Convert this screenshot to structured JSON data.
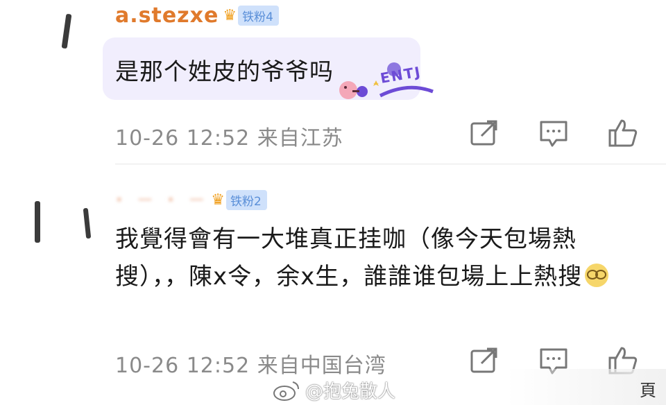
{
  "comments": [
    {
      "username": "a.stezxe",
      "fan_badge": "铁粉4",
      "text": "是那个姓皮的爷爷吗",
      "sticker_label": "ENTJ",
      "timestamp": "10-26 12:52",
      "location": "来自江苏"
    },
    {
      "username": "· ─ · ─",
      "fan_badge": "铁粉2",
      "text": "我覺得會有一大堆真正挂咖（像今天包場熱搜），，陳x令，余x生，誰誰谁包場上上熱搜",
      "timestamp": "10-26 12:52",
      "location": "来自中国台湾"
    }
  ],
  "icons": {
    "share": "share-icon",
    "reply": "comment-icon",
    "like": "thumbs-up-icon",
    "crown": "crown-icon",
    "weibo": "weibo-logo-icon"
  },
  "watermark": "@抱兔散人",
  "corner_text": "頁",
  "colors": {
    "username": "#e07a2c",
    "badge_bg": "#cfe1fb",
    "badge_text": "#5a8fd8",
    "bubble_bg": "#f1eefd",
    "meta_text": "#8a8a8a"
  }
}
